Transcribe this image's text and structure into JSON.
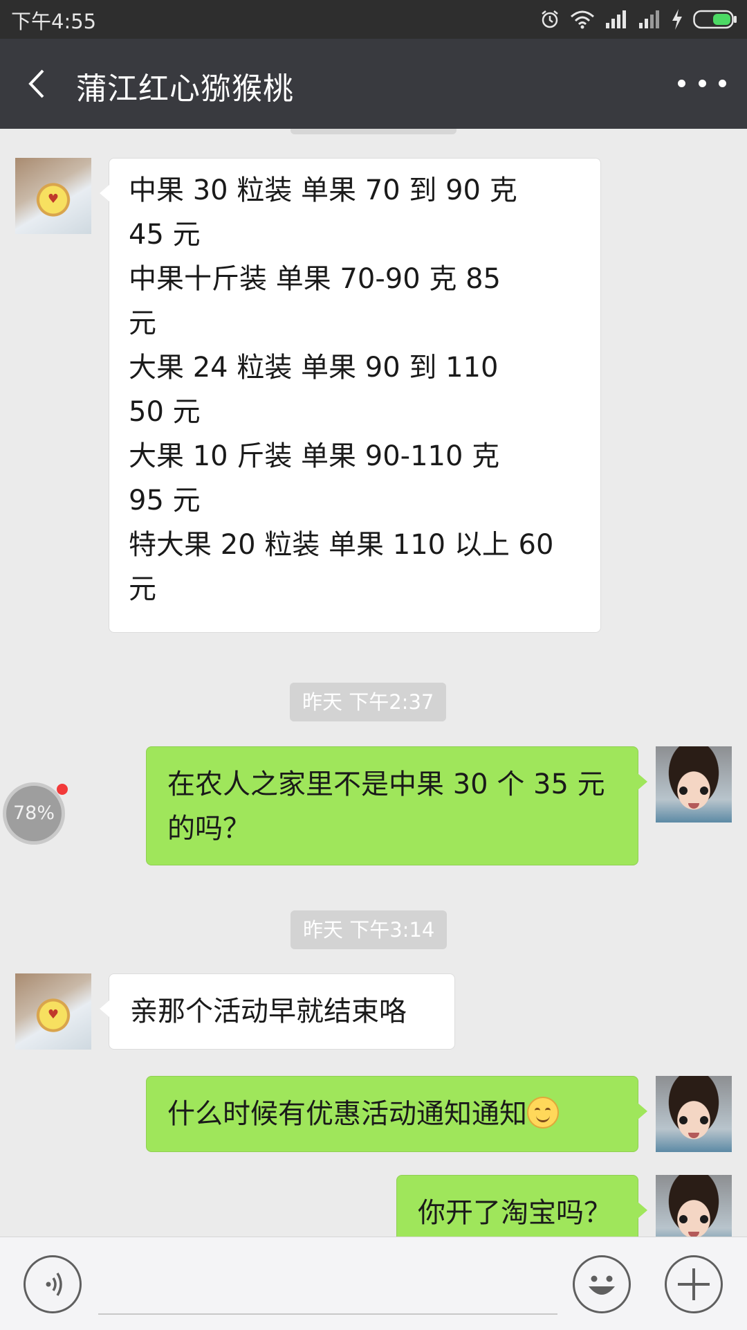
{
  "status_bar": {
    "time": "下午4:55",
    "icons": [
      "alarm-icon",
      "wifi-icon",
      "signal-icon",
      "signal-icon",
      "charging-icon",
      "battery-icon"
    ],
    "battery_color": "#4cd964"
  },
  "header": {
    "title": "蒲江红心猕猴桃",
    "back_icon": "chevron-left-icon",
    "more_icon": "more-dots-icon"
  },
  "messages": [
    {
      "side": "left",
      "sender": "seller",
      "lines": [
        "中果 30 粒装      单果 70 到 90 克",
        "45 元",
        "中果十斤装       单果 70-90 克     85",
        "元",
        "大果 24 粒装        单果 90 到 110",
        "50 元",
        "大果 10 斤装       单果 90-110 克",
        "95 元",
        "特大果 20 粒装     单果 110 以上 60",
        "元"
      ]
    },
    {
      "type": "timestamp",
      "text": "昨天 下午2:37"
    },
    {
      "side": "right",
      "sender": "me",
      "lines": [
        "在农人之家里不是中果 30 个 35 元",
        "的吗？"
      ]
    },
    {
      "type": "timestamp",
      "text": "昨天 下午3:14"
    },
    {
      "side": "left",
      "sender": "seller",
      "lines": [
        "亲那个活动早就结束咯"
      ]
    },
    {
      "side": "right",
      "sender": "me",
      "lines": [
        "什么时候有优惠活动通知通知"
      ],
      "emoji": "smile-emoji"
    },
    {
      "side": "right",
      "sender": "me",
      "lines": [
        "你开了淘宝吗？"
      ]
    }
  ],
  "float_widget": {
    "text": "78%",
    "dot_color": "#f23a3a"
  },
  "input_bar": {
    "voice_icon": "voice-icon",
    "emoji_icon": "emoji-icon",
    "plus_icon": "plus-icon"
  },
  "colors": {
    "header_bg": "#393a3f",
    "chat_bg": "#ebebeb",
    "bubble_me": "#9fe65b",
    "bubble_other": "#ffffff"
  }
}
